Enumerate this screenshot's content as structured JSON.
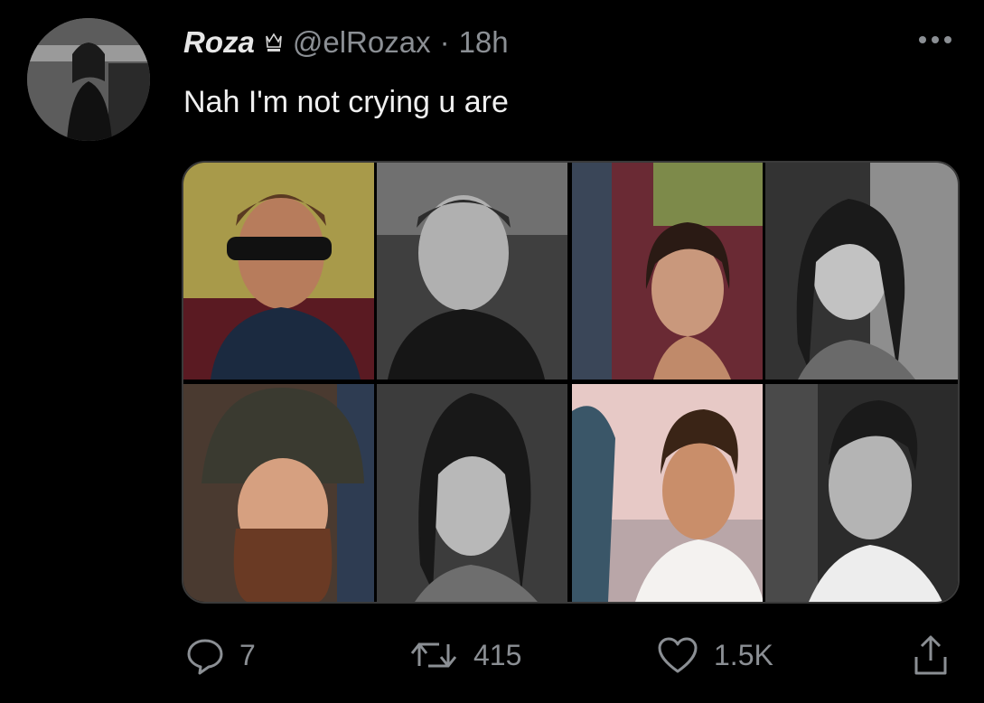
{
  "tweet": {
    "display_name": "Roza",
    "name_badge_icon": "crown-icon",
    "handle": "@elRozax",
    "separator": "·",
    "time": "18h",
    "text": "Nah I'm not crying u are",
    "media_tile_count": 8
  },
  "actions": {
    "reply_count": "7",
    "retweet_count": "415",
    "like_count": "1.5K"
  },
  "icons": {
    "more": "more-icon",
    "reply": "reply-icon",
    "retweet": "retweet-icon",
    "like": "heart-icon",
    "share": "share-icon"
  },
  "colors": {
    "background": "#000000",
    "text": "#ffffff",
    "secondary": "#8b8f94"
  }
}
